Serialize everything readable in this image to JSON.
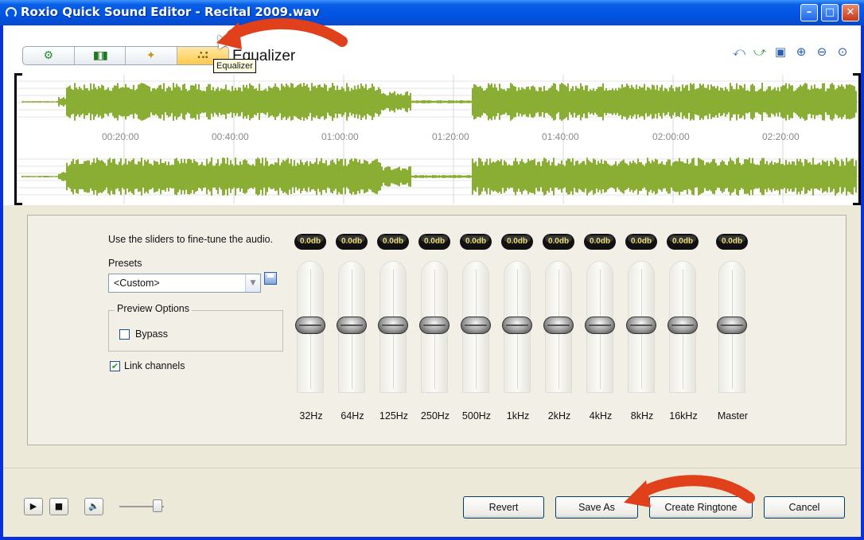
{
  "window": {
    "title": "Roxio Quick Sound Editor - Recital 2009.wav"
  },
  "toolbar": {
    "tabs": [
      {
        "icon": "edit-tools-icon"
      },
      {
        "icon": "waveform-icon"
      },
      {
        "icon": "magic-wand-icon"
      },
      {
        "icon": "equalizer-icon"
      }
    ],
    "active_label": "Equalizer",
    "tooltip": "Equalizer",
    "right_tools": [
      "undo-icon",
      "redo-icon",
      "zoom-selection-icon",
      "zoom-in-icon",
      "zoom-out-icon",
      "zoom-fit-icon"
    ]
  },
  "timeline": {
    "ticks": [
      "00:20:00",
      "00:40:00",
      "01:00:00",
      "01:20:00",
      "01:40:00",
      "02:00:00",
      "02:20:00"
    ],
    "wave_color": "#8aad34"
  },
  "equalizer": {
    "help_text": "Use the sliders to fine-tune the audio.",
    "presets_label": "Presets",
    "preset_value": "<Custom>",
    "preview_options_label": "Preview Options",
    "bypass_label": "Bypass",
    "bypass_checked": false,
    "link_channels_label": "Link channels",
    "link_channels_checked": true,
    "bands": [
      {
        "label": "32Hz",
        "db": "0.0db",
        "level": 0.5
      },
      {
        "label": "64Hz",
        "db": "0.0db",
        "level": 0.5
      },
      {
        "label": "125Hz",
        "db": "0.0db",
        "level": 0.5
      },
      {
        "label": "250Hz",
        "db": "0.0db",
        "level": 0.5
      },
      {
        "label": "500Hz",
        "db": "0.0db",
        "level": 0.5
      },
      {
        "label": "1kHz",
        "db": "0.0db",
        "level": 0.5
      },
      {
        "label": "2kHz",
        "db": "0.0db",
        "level": 0.5
      },
      {
        "label": "4kHz",
        "db": "0.0db",
        "level": 0.5
      },
      {
        "label": "8kHz",
        "db": "0.0db",
        "level": 0.5
      },
      {
        "label": "16kHz",
        "db": "0.0db",
        "level": 0.5
      }
    ],
    "master": {
      "label": "Master",
      "db": "0.0db",
      "level": 0.5
    }
  },
  "footer": {
    "revert": "Revert",
    "save_as": "Save As",
    "create_ringtone": "Create Ringtone",
    "cancel": "Cancel",
    "volume_level": 0.85
  }
}
